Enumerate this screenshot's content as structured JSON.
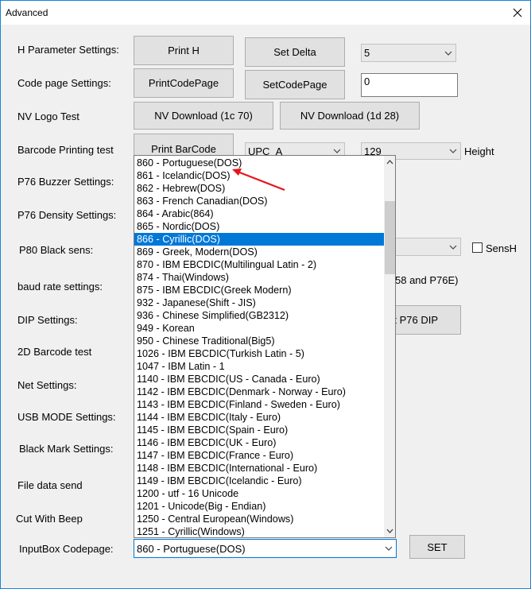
{
  "window": {
    "title": "Advanced",
    "close_glyph": "close-icon"
  },
  "rows": {
    "h_param": {
      "label": "H Parameter Settings:",
      "btn1": "Print H",
      "btn2": "Set Delta",
      "combo": "5"
    },
    "code_page": {
      "label": "Code page Settings:",
      "btn1": "PrintCodePage",
      "btn2": "SetCodePage",
      "input": "0"
    },
    "nv_logo": {
      "label": "NV Logo Test",
      "btn1": "NV Download (1c 70)",
      "btn2": "NV Download (1d 28)"
    },
    "barcode": {
      "label": "Barcode Printing test",
      "btn1": "Print BarCode",
      "combo1": "UPC_A",
      "combo2": "129",
      "suffix": "Height"
    },
    "p76_buzzer": {
      "label": "P76 Buzzer Settings:"
    },
    "p76_density": {
      "label": "P76 Density Settings:"
    },
    "p80_black": {
      "label": "P80 Black sens:",
      "checkbox_label": "SensH"
    },
    "baud": {
      "label": "baud rate settings:",
      "trailing_text": "58 and P76E)"
    },
    "dip": {
      "label": "DIP Settings:",
      "btn_partial": "t P76 DIP"
    },
    "barcode_2d": {
      "label": "2D Barcode test"
    },
    "net": {
      "label": "Net Settings:"
    },
    "usb": {
      "label": "USB MODE Settings:"
    },
    "black_mark": {
      "label": "Black Mark Settings:"
    },
    "file_data": {
      "label": "File data send"
    },
    "cut_beep": {
      "label": "Cut With Beep"
    },
    "inputbox": {
      "label": "InputBox Codepage:",
      "combo": "860 - Portuguese(DOS)",
      "set_btn": "SET"
    }
  },
  "dropdown": {
    "selected_index": 6,
    "items": [
      "860 - Portuguese(DOS)",
      "861 - Icelandic(DOS)",
      "862 - Hebrew(DOS)",
      "863 - French Canadian(DOS)",
      "864 - Arabic(864)",
      "865 - Nordic(DOS)",
      "866 - Cyrillic(DOS)",
      "869 - Greek, Modern(DOS)",
      "870 - IBM EBCDIC(Multilingual Latin - 2)",
      "874 - Thai(Windows)",
      "875 - IBM EBCDIC(Greek Modern)",
      "932 - Japanese(Shift - JIS)",
      "936 - Chinese Simplified(GB2312)",
      "949 - Korean",
      "950 - Chinese Traditional(Big5)",
      "1026 - IBM EBCDIC(Turkish Latin - 5)",
      "1047 - IBM Latin - 1",
      "1140 - IBM EBCDIC(US - Canada - Euro)",
      "1142 - IBM EBCDIC(Denmark - Norway - Euro)",
      "1143 - IBM EBCDIC(Finland - Sweden - Euro)",
      "1144 - IBM EBCDIC(Italy - Euro)",
      "1145 - IBM EBCDIC(Spain - Euro)",
      "1146 - IBM EBCDIC(UK - Euro)",
      "1147 - IBM EBCDIC(France - Euro)",
      "1148 - IBM EBCDIC(International - Euro)",
      "1149 - IBM EBCDIC(Icelandic - Euro)",
      "1200 - utf - 16 Unicode",
      "1201 - Unicode(Big - Endian)",
      "1250 - Central European(Windows)",
      "1251 - Cyrillic(Windows)"
    ]
  },
  "colors": {
    "accent": "#0078d7",
    "annotation_arrow": "#e8141b",
    "window_bg": "#f0f0f0"
  }
}
